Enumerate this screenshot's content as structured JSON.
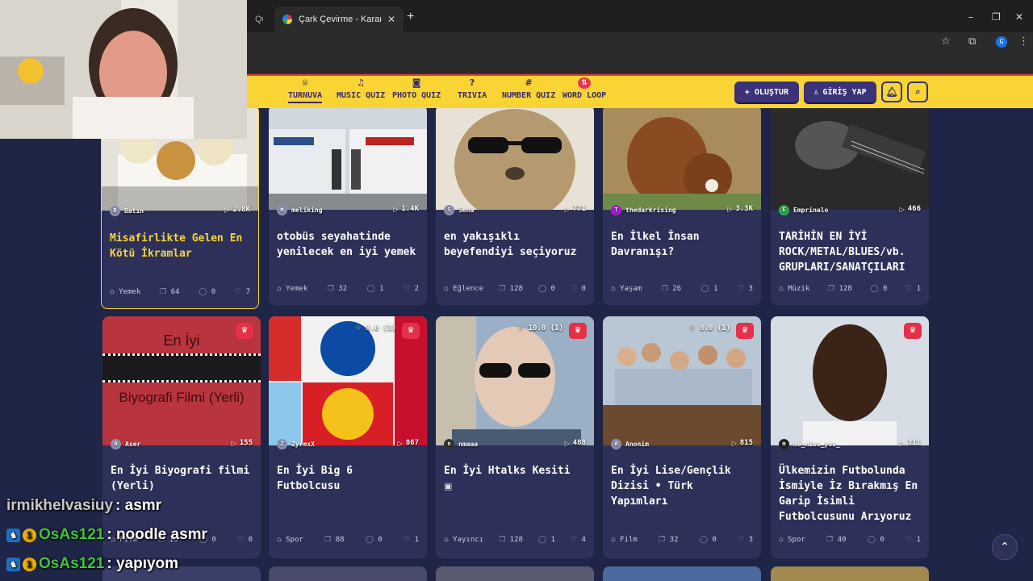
{
  "browser": {
    "tab_active_title": "Çark Çevirme - Karar Çarkı!",
    "tab_inactive_title": "Qu",
    "new_tab": "+",
    "window_controls": [
      "–",
      "❐",
      "✕"
    ],
    "profile_initial": "G"
  },
  "nav": {
    "items": [
      {
        "label": "TURNUVA",
        "icon": "trophy-icon",
        "glyph": "♕"
      },
      {
        "label": "MUSIC QUIZ",
        "icon": "music-icon",
        "glyph": "♫"
      },
      {
        "label": "PHOTO QUIZ",
        "icon": "camera-icon",
        "glyph": "◙"
      },
      {
        "label": "TRIVIA",
        "icon": "question-icon",
        "glyph": "?"
      },
      {
        "label": "NUMBER QUIZ",
        "icon": "hash-icon",
        "glyph": "#"
      },
      {
        "label": "WORD LOOP",
        "icon": "sort-icon",
        "glyph": "⇅"
      }
    ],
    "create_label": "+ OLUŞTUR",
    "login_label": "GİRİŞ YAP",
    "login_glyph": "♙",
    "bell_glyph": "♫",
    "search_glyph": "⌕"
  },
  "cards": [
    {
      "author": "Batın",
      "avatar": "B",
      "plays": "2.8K",
      "title": "Misafirlikte Gelen En Kötü İkramlar",
      "category": "Yemek",
      "items": "64",
      "comments": "0",
      "likes": "7"
    },
    {
      "author": "meliking",
      "avatar": "m",
      "plays": "1.4K",
      "title": "otobüs seyahatinde yenilecek en iyi yemek",
      "category": "Yemek",
      "items": "32",
      "comments": "1",
      "likes": "2"
    },
    {
      "author": "Sena",
      "avatar": "S",
      "plays": "771",
      "title": "en yakışıklı beyefendiyi seçiyoruz",
      "category": "Eğlence",
      "items": "128",
      "comments": "0",
      "likes": "0"
    },
    {
      "author": "thedarkrising",
      "avatar": "T",
      "plays": "3.3K",
      "title": "En İlkel İnsan Davranışı?",
      "category": "Yaşam",
      "items": "26",
      "comments": "1",
      "likes": "3"
    },
    {
      "author": "Emprinalo",
      "avatar": "E",
      "plays": "466",
      "title": "TARİHİN EN İYİ ROCK/METAL/BLUES/vb. GRUPLARI/SANATÇILARI",
      "category": "Müzik",
      "items": "128",
      "comments": "0",
      "likes": "1"
    },
    {
      "author": "Aser",
      "avatar": "A",
      "plays": "155",
      "title": "En İyi Biyografi filmi (Yerli)",
      "category": "Film",
      "items": "16",
      "comments": "0",
      "likes": "0",
      "rating": "",
      "thumb_text_top": "En İyi",
      "thumb_text_bottom": "Biyografi Filmi (Yerli)"
    },
    {
      "author": "ZyrexX",
      "avatar": "Z",
      "plays": "867",
      "title": "En İyi Big 6 Futbolcusu",
      "category": "Spor",
      "items": "88",
      "comments": "0",
      "likes": "1",
      "rating": "8.0 (3)"
    },
    {
      "author": "nmaaa",
      "avatar": "n",
      "plays": "488",
      "title": "En İyi Htalks Kesiti",
      "category": "Yayıncı",
      "items": "128",
      "comments": "1",
      "likes": "4",
      "rating": "10.0 (1)"
    },
    {
      "author": "Anonim",
      "avatar": "A",
      "plays": "815",
      "title": "En İyi Lise/Gençlik Dizisi • Türk Yapımları",
      "category": "Film",
      "items": "32",
      "comments": "0",
      "likes": "3",
      "rating": "8.0 (1)"
    },
    {
      "author": "me_miss_you_",
      "avatar": "m",
      "plays": "311",
      "title": "Ülkemizin Futbolunda İsmiyle İz Bırakmış En Garip İsimli Futbolcusunu Arıyoruz",
      "category": "Spor",
      "items": "40",
      "comments": "0",
      "likes": "1"
    }
  ],
  "chat": [
    {
      "user": "irmikhelvasiuy",
      "message": ": asmr"
    },
    {
      "user": "OsAs121",
      "message": ": noodle asmr"
    },
    {
      "user": "OsAs121",
      "message": ": yapıyom"
    }
  ],
  "colors": {
    "accent_yellow": "#f8d535",
    "brand_purple": "#3b3277",
    "crown_red": "#e5304a",
    "card_bg": "#2d3159",
    "page_bg": "#1f2547"
  }
}
